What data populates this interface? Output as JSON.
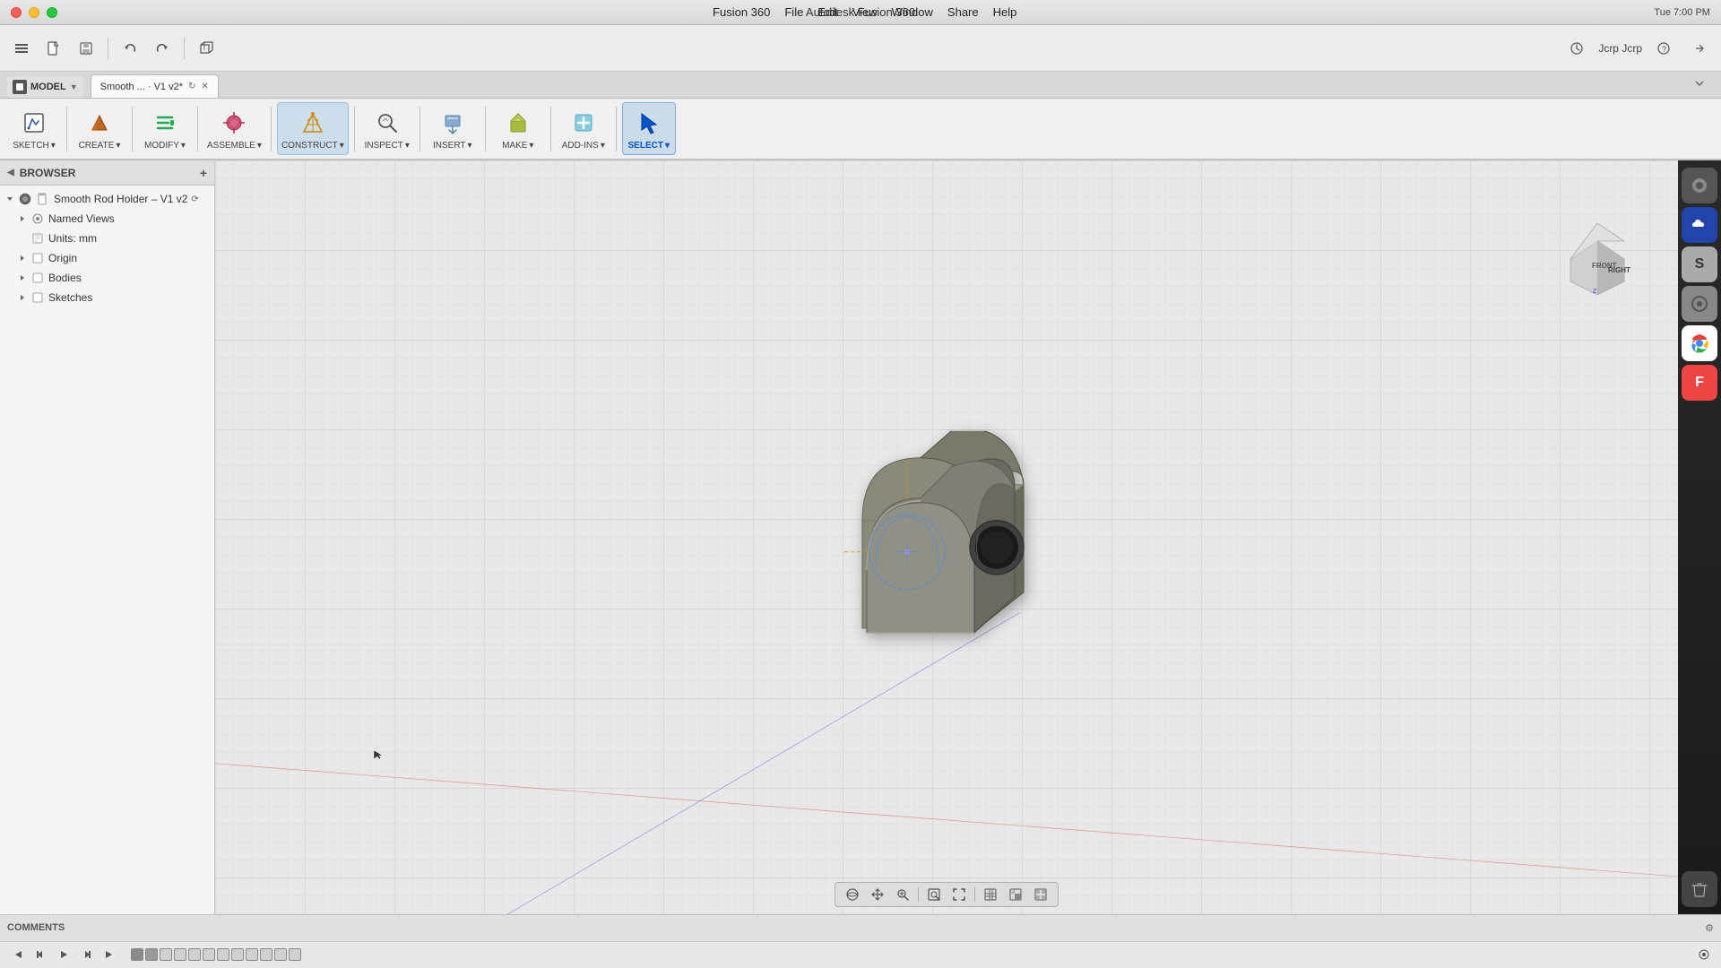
{
  "app": {
    "title": "Autodesk Fusion 360",
    "window_title": "Autodesk Fusion 360"
  },
  "mac": {
    "time": "Tue 7:00 PM",
    "menu_items": [
      "Fusion 360",
      "File",
      "Edit",
      "View",
      "Window",
      "Share",
      "Help"
    ],
    "user": "Jcrp Jcrp"
  },
  "toolbar2": {
    "undo_label": "↩",
    "redo_label": "↪"
  },
  "tab": {
    "label": "Smooth ... · V1 v2*",
    "model_label": "MODEL"
  },
  "main_toolbar": {
    "sketch_label": "SKETCH",
    "create_label": "CREATE",
    "modify_label": "MODIFY",
    "assemble_label": "ASSEMBLE",
    "construct_label": "CONSTRUCT",
    "inspect_label": "INSPECT",
    "insert_label": "INSERT",
    "make_label": "MAKE",
    "addins_label": "ADD-INS",
    "select_label": "SELECT"
  },
  "browser": {
    "header": "BROWSER",
    "document_name": "Smooth Rod Holder – V1 v2",
    "named_views": "Named Views",
    "units": "Units: mm",
    "origin": "Origin",
    "bodies": "Bodies",
    "sketches": "Sketches"
  },
  "viewport": {
    "background_color": "#e5e5e5",
    "grid_color": "#cccccc",
    "axis": {
      "front_label": "FRONT",
      "right_label": "RIGHT"
    }
  },
  "bottom": {
    "comments_label": "COMMENTS",
    "gear_icon": "⚙"
  },
  "timeline": {
    "marks_count": 12
  },
  "dock_icons": [
    "S",
    "C",
    "F"
  ],
  "colors": {
    "accent_blue": "#0078d4",
    "accent_orange": "#d4880a",
    "background": "#e8e8e8",
    "sidebar_bg": "#f5f5f5",
    "toolbar_bg": "#f0f0f0"
  },
  "icons": {
    "expand_arrow": "▶",
    "collapse_arrow": "▼",
    "folder": "📁",
    "eye": "👁",
    "component": "⬡",
    "triangle_right": "▶",
    "search": "🔍",
    "plus": "+",
    "gear": "⚙",
    "camera": "📷",
    "clock": "🕐",
    "grid": "▦",
    "home": "⌂"
  }
}
